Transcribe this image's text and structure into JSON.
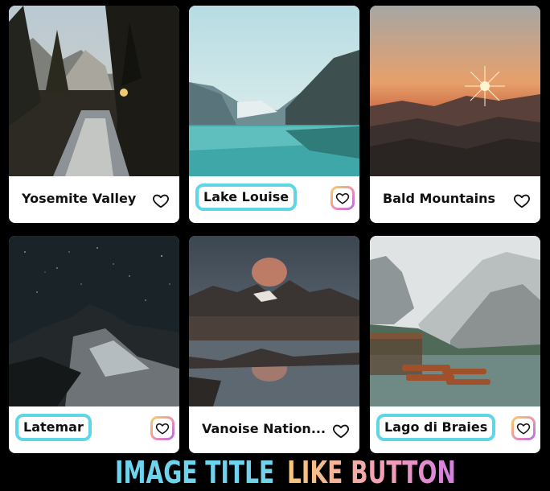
{
  "cards": [
    {
      "title": "Yosemite Valley"
    },
    {
      "title": "Lake Louise"
    },
    {
      "title": "Bald Mountains"
    },
    {
      "title": "Latemar"
    },
    {
      "title": "Vanoise Nation..."
    },
    {
      "title": "Lago di Braies"
    }
  ],
  "legend": {
    "image_title": "IMAGE TITLE",
    "like_button": "LIKE BUTTON"
  },
  "colors": {
    "title_highlight": "#5ed6e8",
    "like_gradient_start": "#f7d35a",
    "like_gradient_end": "#b06be8"
  },
  "icons": {
    "like": "heart-icon"
  }
}
